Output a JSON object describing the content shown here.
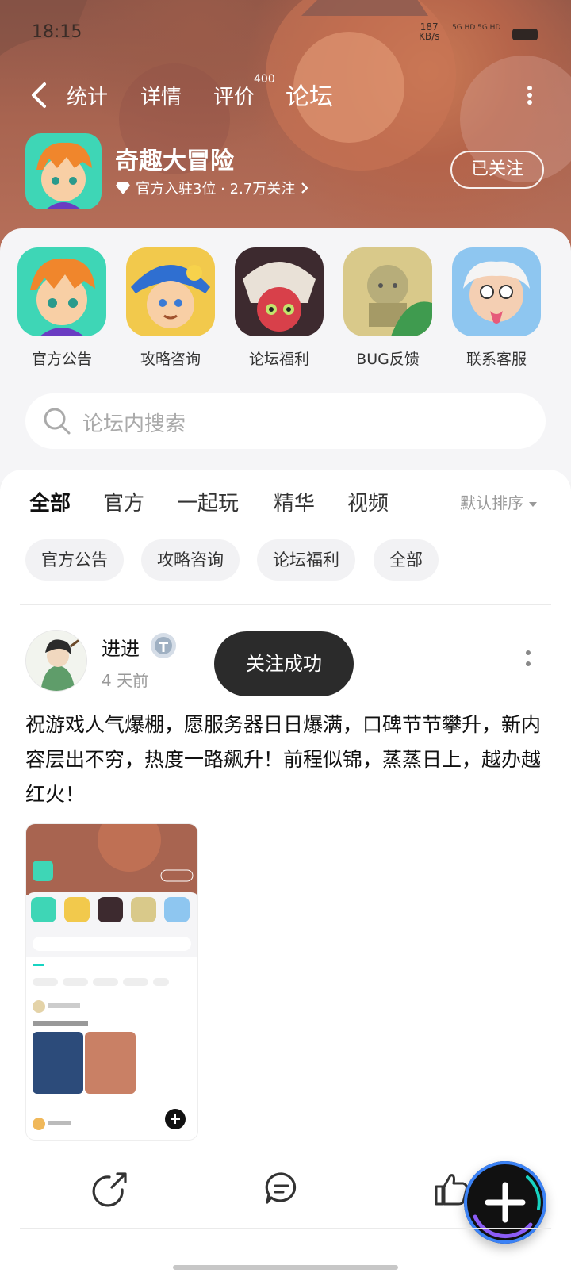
{
  "status_bar": {
    "time": "18:15",
    "speed": "187",
    "speed_unit": "KB/s",
    "network": "5G HD 5G HD"
  },
  "nav": {
    "tabs": [
      {
        "label": "统计"
      },
      {
        "label": "详情"
      },
      {
        "label": "评价"
      },
      {
        "label": "论坛"
      }
    ],
    "review_badge": "400",
    "active_tab": "论坛"
  },
  "game": {
    "name": "奇趣大冒险",
    "meta": "官方入驻3位 · 2.7万关注",
    "follow_label": "已关注"
  },
  "shortcuts": [
    {
      "label": "官方公告"
    },
    {
      "label": "攻略咨询"
    },
    {
      "label": "论坛福利"
    },
    {
      "label": "BUG反馈"
    },
    {
      "label": "联系客服"
    }
  ],
  "search": {
    "placeholder": "论坛内搜索"
  },
  "feed_tabs": [
    {
      "label": "全部"
    },
    {
      "label": "官方"
    },
    {
      "label": "一起玩"
    },
    {
      "label": "精华"
    },
    {
      "label": "视频"
    }
  ],
  "sort_label": "默认排序",
  "chips": [
    {
      "label": "官方公告"
    },
    {
      "label": "攻略咨询"
    },
    {
      "label": "论坛福利"
    },
    {
      "label": "全部"
    }
  ],
  "post": {
    "username": "进进",
    "time": "4 天前",
    "toast": "关注成功",
    "text": "祝游戏人气爆棚，愿服务器日日爆满，口碑节节攀升，新内容层出不穷，热度一路飙升！前程似锦，蒸蒸日上，越办越红火！"
  },
  "colors": {
    "accent": "#17d4c2",
    "hero_bg": "#a86450",
    "toast_bg": "#2b2b2b"
  }
}
